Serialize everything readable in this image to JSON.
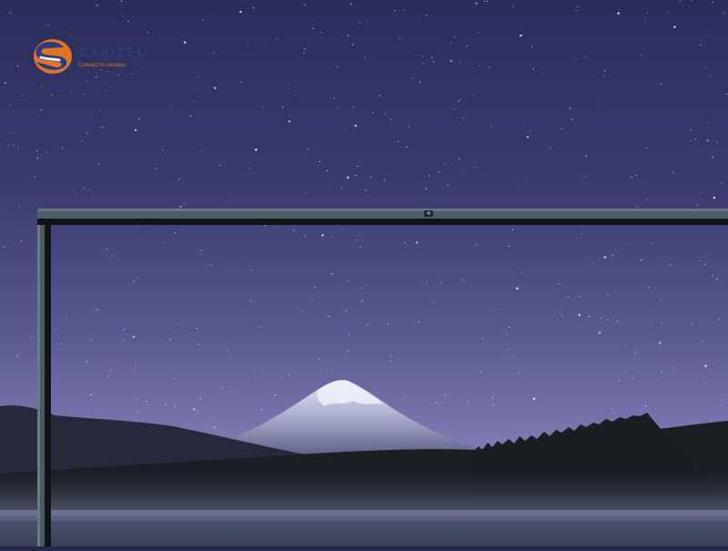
{
  "brand": {
    "name": "SAVITEL",
    "slogan": "Connect to success",
    "colors": {
      "primary": "#2f3d7e",
      "accent": "#f07a22"
    }
  },
  "scene": {
    "subject": "starry-night-mountain",
    "colors": {
      "sky_top": "#2c2f5c",
      "sky_horizon": "#7873ad",
      "snow": "#dde0f0"
    }
  }
}
